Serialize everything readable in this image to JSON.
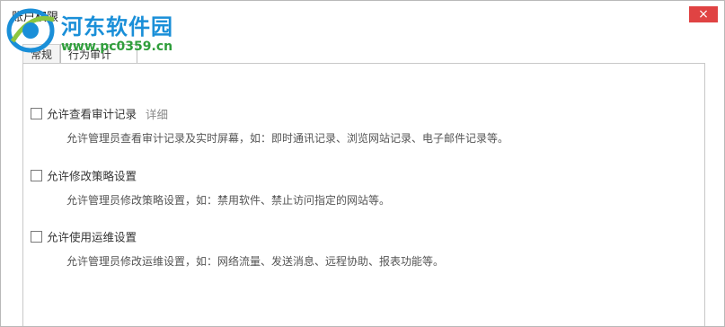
{
  "window": {
    "title": "账户权限",
    "close_glyph": "×"
  },
  "watermark": {
    "brand": "河东软件园",
    "url": "www.pc0359.cn"
  },
  "tabs": [
    {
      "label": "常规",
      "active": false
    },
    {
      "label": "行为审计",
      "active": true
    }
  ],
  "options": [
    {
      "label": "允许查看审计记录",
      "link": "详细",
      "description": "允许管理员查看审计记录及实时屏幕，如：即时通讯记录、浏览网站记录、电子邮件记录等。",
      "checked": false
    },
    {
      "label": "允许修改策略设置",
      "description": "允许管理员修改策略设置，如：禁用软件、禁止访问指定的网站等。",
      "checked": false
    },
    {
      "label": "允许使用运维设置",
      "description": "允许管理员修改运维设置，如：网络流量、发送消息、远程协助、报表功能等。",
      "checked": false
    }
  ],
  "colors": {
    "close": "#e04343",
    "watermark_blue": "#1a8fd8",
    "watermark_green": "#2f9e3b"
  },
  "icons": {
    "close": "close-icon",
    "logo": "logo-icon"
  }
}
